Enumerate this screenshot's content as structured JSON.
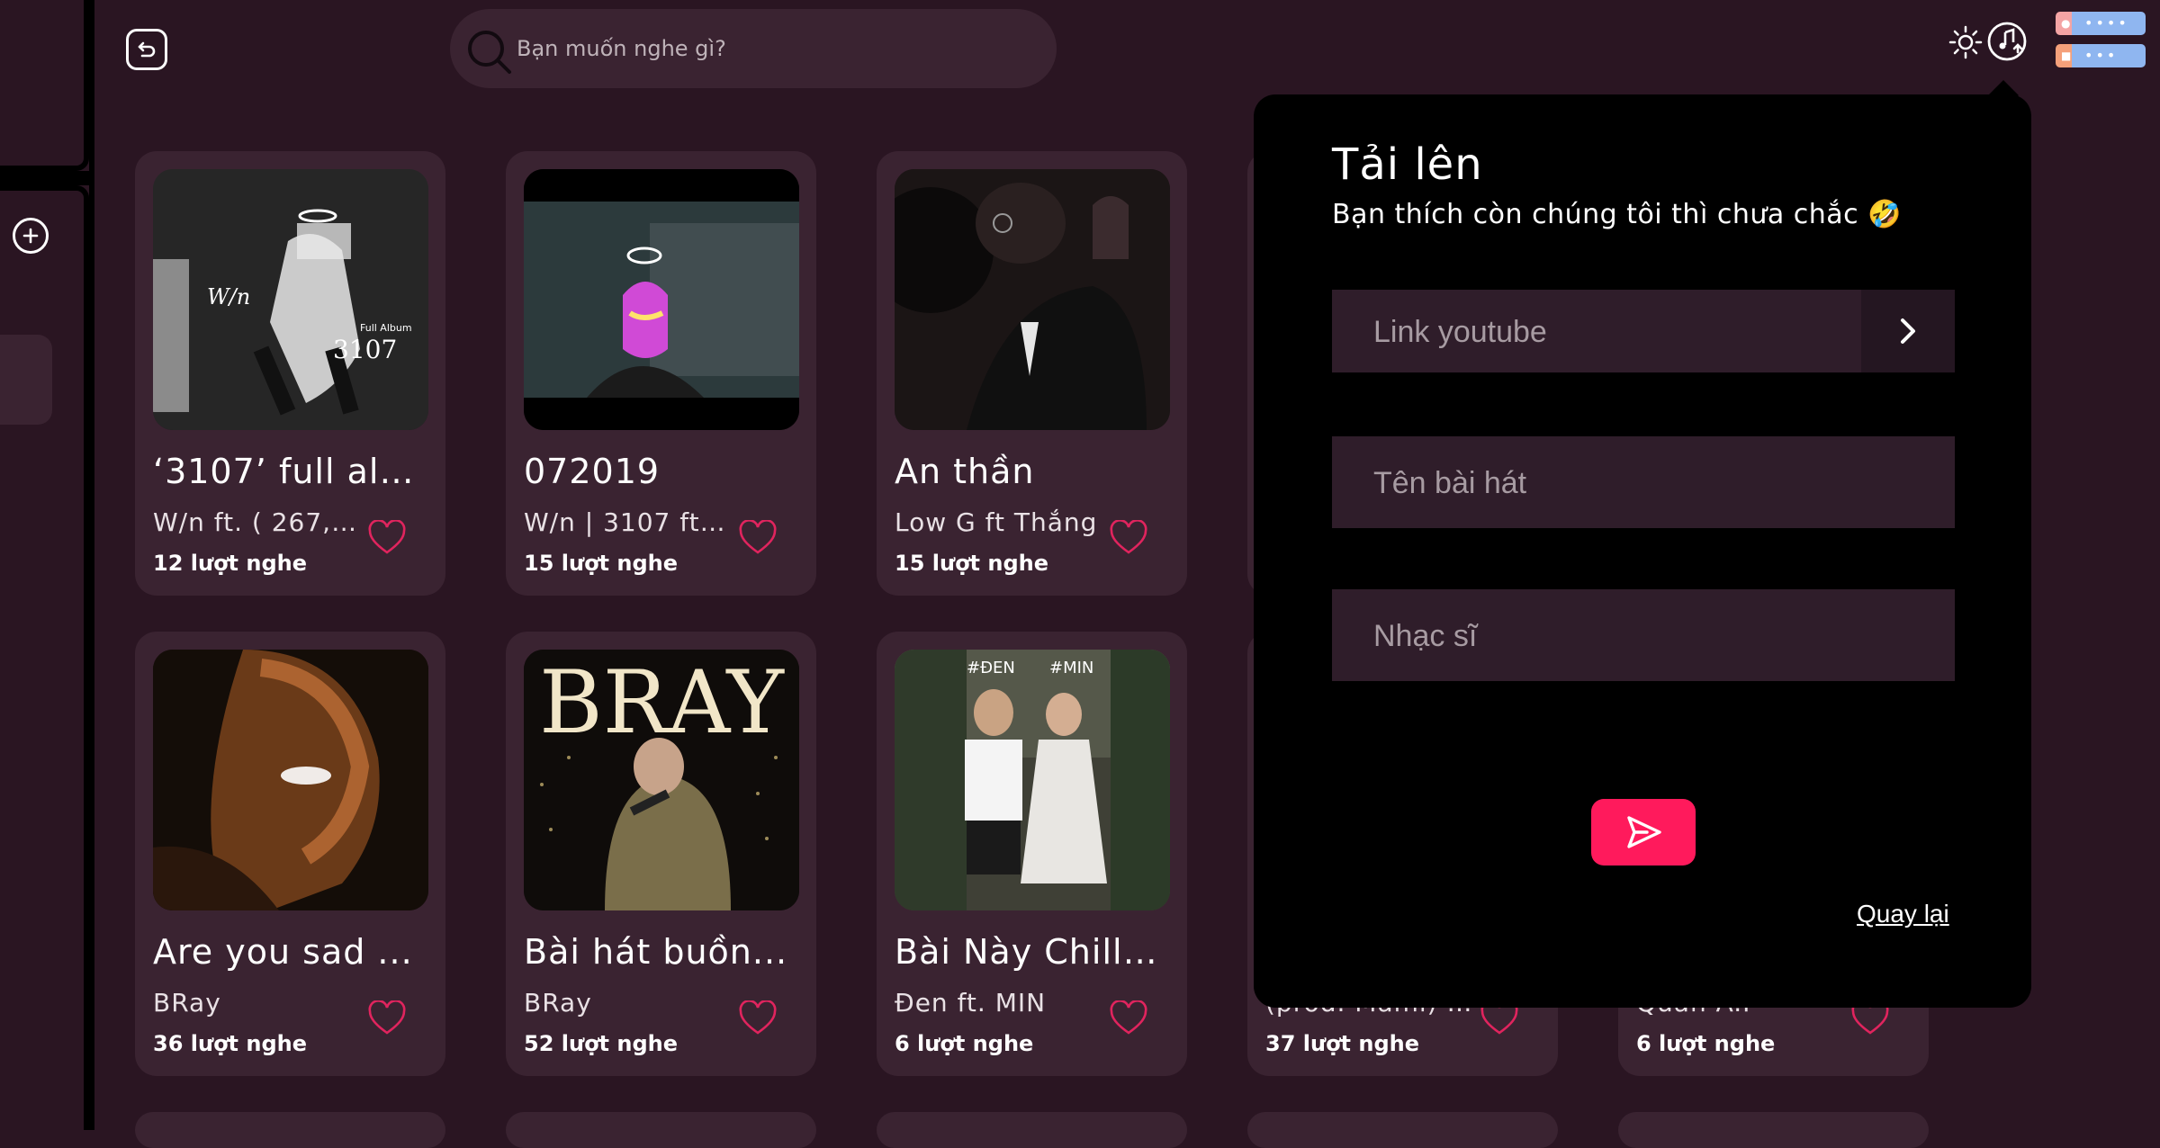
{
  "search": {
    "placeholder": "Bạn muốn nghe gì?"
  },
  "icons": {
    "back": "back-icon",
    "search": "search-icon",
    "theme": "sun-icon",
    "upload": "music-upload-icon",
    "add": "plus-icon",
    "heart": "heart-icon",
    "send": "send-icon"
  },
  "colors": {
    "background": "#2a1522",
    "card": "#3a2331",
    "panel": "#000000",
    "accent": "#ff1a5c",
    "heart": "#e0245e"
  },
  "songs": [
    {
      "title": "‘3107’ full alb...",
      "artist": "W/n ft. ( 267, ...",
      "plays": "12 lượt nghe",
      "cover_text": "W/n",
      "cover_sub": "Full Album 3107"
    },
    {
      "title": "072019",
      "artist": "W/n | 3107 ft ...",
      "plays": "15 lượt nghe"
    },
    {
      "title": "An thần",
      "artist": "Low G ft Thắng",
      "plays": "15 lượt nghe"
    },
    {
      "title": "Are you sad ...",
      "artist": "BRay",
      "plays": "36 lượt nghe"
    },
    {
      "title": "Bài hát buồn...",
      "artist": "BRay",
      "plays": "52 lượt nghe",
      "cover_text": "BRAY"
    },
    {
      "title": "Bài Này Chill ...",
      "artist": "Đen ft. MIN",
      "plays": "6 lượt nghe",
      "cover_tags": [
        "#ĐEN",
        "#MIN"
      ]
    }
  ],
  "hidden_cards": [
    {
      "artist": "(prod. Mami) |...",
      "plays": "37 lượt nghe"
    },
    {
      "artist": "Quân A.P",
      "plays": "6 lượt nghe"
    }
  ],
  "upload": {
    "title": "Tải lên",
    "subtitle": "Bạn thích còn chúng tôi thì chưa chắc 🤣",
    "youtube_placeholder": "Link youtube",
    "song_name_placeholder": "Tên bài hát",
    "composer_placeholder": "Nhạc sĩ",
    "back_label": "Quay lại"
  }
}
